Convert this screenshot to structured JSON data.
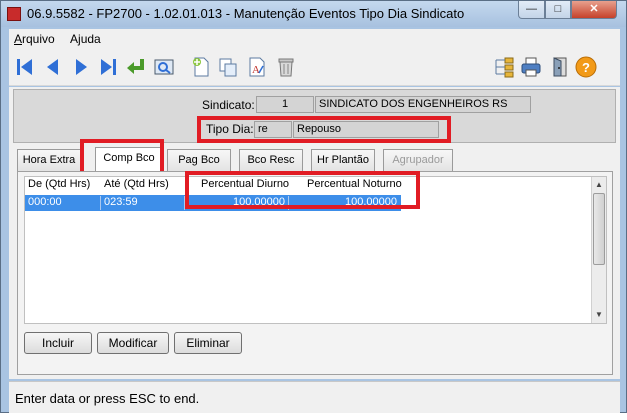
{
  "window": {
    "title": "06.9.5582 - FP2700 - 1.02.01.013 - Manutenção Eventos Tipo Dia Sindicato",
    "controls": {
      "minimize": "—",
      "maximize": "□",
      "close": "✕"
    }
  },
  "menu": {
    "items": [
      {
        "label": "Arquivo",
        "accel": "A",
        "rest": "rquivo"
      },
      {
        "label": "Ajuda",
        "accel": "j",
        "pre": "A",
        "rest": "uda"
      }
    ]
  },
  "toolbar": {
    "icons": [
      "first-record-icon",
      "previous-record-icon",
      "next-record-icon",
      "last-record-icon",
      "return-icon",
      "preview-icon",
      "new-document-icon",
      "copy-icon",
      "edit-text-icon",
      "trash-icon",
      "hierarchy-icon",
      "print-icon",
      "exit-door-icon",
      "help-icon"
    ],
    "colors": {
      "nav_blue": "#2f6fd6",
      "return_green": "#4a9a2a",
      "help_orange": "#f29a18"
    }
  },
  "header": {
    "sindicato_label": "Sindicato:",
    "sindicato_code": "1",
    "sindicato_name": "SINDICATO DOS ENGENHEIROS RS",
    "tipo_dia_label": "Tipo Dia:",
    "tipo_dia_code": "re",
    "tipo_dia_name": "Repouso"
  },
  "tabs": [
    {
      "label": "Hora Extra",
      "state": "normal"
    },
    {
      "label": "Comp Bco",
      "state": "active"
    },
    {
      "label": "Pag Bco",
      "state": "normal"
    },
    {
      "label": "Bco Resc",
      "state": "normal"
    },
    {
      "label": "Hr Plantão",
      "state": "normal"
    },
    {
      "label": "Agrupador",
      "state": "disabled"
    }
  ],
  "grid": {
    "columns": [
      "De (Qtd Hrs)",
      "Até (Qtd Hrs)",
      "Percentual Diurno",
      "Percentual Noturno"
    ],
    "rows": [
      {
        "de": "000:00",
        "ate": "023:59",
        "diurno": "100,00000",
        "noturno": "100,00000"
      }
    ]
  },
  "buttons": {
    "incluir": "Incluir",
    "modificar": "Modificar",
    "eliminar": "Eliminar"
  },
  "status": {
    "message": "Enter data or press ESC to end."
  },
  "highlight_color": "#e11c24",
  "selection_color": "#3d8ee9"
}
